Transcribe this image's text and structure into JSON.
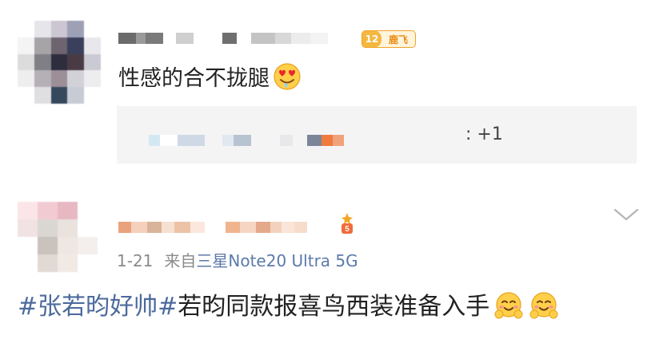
{
  "colors": {
    "hashtag": "#4c6a9c",
    "meta": "#8a8a8a",
    "device": "#5b7aa8",
    "badge": "#f0a32a"
  },
  "comment1": {
    "badge": {
      "level": "12",
      "name": "鹿飞"
    },
    "text": "性感的合不拢腿",
    "emoji": "heart-eyes-drooling-emoji",
    "replies": {
      "count": ": +1"
    }
  },
  "comment2": {
    "date": "1-21",
    "source_prefix": "来自",
    "device": "三星Note20 Ultra 5G",
    "hashtag": "#张若昀好帅#",
    "text": "若昀同款报喜鸟西装准备入手",
    "emojis": [
      "blushing-hands-emoji",
      "blushing-hands-emoji"
    ]
  }
}
